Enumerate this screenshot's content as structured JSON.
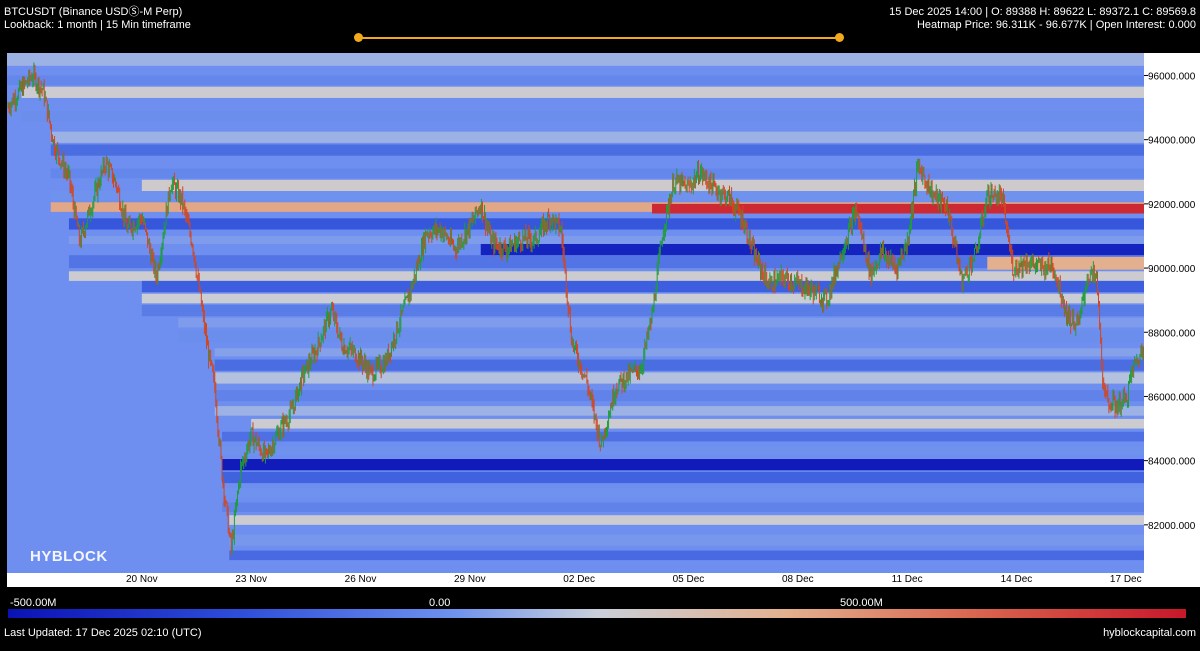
{
  "header": {
    "symbol": "BTCUSDT (Binance USDⓈ-M Perp)",
    "subtitle": "Lookback: 1 month | 15 Min timeframe",
    "ohlc": "15 Dec 2025 14:00 | O: 89388 H: 89622 L: 89372.1 C: 89569.8",
    "heatmap_info": "Heatmap Price: 96.311K - 96.677K | Open Interest: 0.000"
  },
  "watermark": "HYBLOCK",
  "footer": {
    "last_updated": "Last Updated: 17 Dec 2025 02:10 (UTC)",
    "site": "hyblockcapital.com"
  },
  "colors": {
    "background": "#000000",
    "plot_base": "#6e8ff0",
    "up_candle": "#1f9d3a",
    "down_candle": "#d2461f",
    "slider": "#f2a91c"
  },
  "colorbar": {
    "min_label": "-500.00M",
    "mid_label": "0.00",
    "max_label": "500.00M"
  },
  "chart_data": {
    "type": "heatmap",
    "title": "BTCUSDT (Binance USDⓈ-M Perp)",
    "x_ticks": [
      "20 Nov",
      "23 Nov",
      "26 Nov",
      "29 Nov",
      "02 Dec",
      "05 Dec",
      "08 Dec",
      "11 Dec",
      "14 Dec",
      "17 Dec"
    ],
    "x_tick_days": [
      4,
      7,
      10,
      13,
      16,
      19,
      22,
      25,
      28,
      31
    ],
    "x_range_days": [
      0.3,
      31.5
    ],
    "y_ticks": [
      "96000.000",
      "94000.000",
      "92000.000",
      "90000.000",
      "88000.000",
      "86000.000",
      "84000.000",
      "82000.000"
    ],
    "y_tick_values": [
      96000,
      94000,
      92000,
      90000,
      88000,
      86000,
      84000,
      82000
    ],
    "ylim": [
      80500,
      96700
    ],
    "colorbar_range": [
      -500000000,
      500000000
    ],
    "price_path": [
      [
        0.3,
        95000
      ],
      [
        0.7,
        95600
      ],
      [
        1.0,
        96000
      ],
      [
        1.3,
        95500
      ],
      [
        1.6,
        93800
      ],
      [
        2.0,
        92800
      ],
      [
        2.3,
        90800
      ],
      [
        2.6,
        91900
      ],
      [
        3.0,
        93300
      ],
      [
        3.3,
        92600
      ],
      [
        3.6,
        91200
      ],
      [
        4.0,
        91600
      ],
      [
        4.4,
        89700
      ],
      [
        4.8,
        92700
      ],
      [
        5.1,
        92100
      ],
      [
        5.4,
        90700
      ],
      [
        5.8,
        87500
      ],
      [
        6.0,
        86300
      ],
      [
        6.2,
        83600
      ],
      [
        6.45,
        81200
      ],
      [
        6.7,
        83700
      ],
      [
        7.0,
        84800
      ],
      [
        7.4,
        84100
      ],
      [
        7.8,
        85000
      ],
      [
        8.1,
        85500
      ],
      [
        8.4,
        86600
      ],
      [
        8.8,
        87500
      ],
      [
        9.2,
        88700
      ],
      [
        9.5,
        87600
      ],
      [
        9.9,
        87300
      ],
      [
        10.3,
        86700
      ],
      [
        10.7,
        87100
      ],
      [
        11.0,
        88100
      ],
      [
        11.4,
        89400
      ],
      [
        11.8,
        91100
      ],
      [
        12.2,
        91200
      ],
      [
        12.6,
        90600
      ],
      [
        13.0,
        91300
      ],
      [
        13.3,
        92000
      ],
      [
        13.6,
        90800
      ],
      [
        14.0,
        90600
      ],
      [
        14.4,
        90900
      ],
      [
        14.8,
        90900
      ],
      [
        15.2,
        91600
      ],
      [
        15.5,
        91200
      ],
      [
        15.8,
        87700
      ],
      [
        16.2,
        86500
      ],
      [
        16.6,
        84500
      ],
      [
        17.0,
        86300
      ],
      [
        17.3,
        86600
      ],
      [
        17.7,
        86900
      ],
      [
        18.0,
        88500
      ],
      [
        18.3,
        91200
      ],
      [
        18.6,
        92700
      ],
      [
        19.0,
        92500
      ],
      [
        19.3,
        93000
      ],
      [
        19.7,
        92500
      ],
      [
        20.1,
        92200
      ],
      [
        20.5,
        91500
      ],
      [
        20.8,
        90400
      ],
      [
        21.2,
        89500
      ],
      [
        21.6,
        89700
      ],
      [
        22.0,
        89500
      ],
      [
        22.4,
        89300
      ],
      [
        22.8,
        89000
      ],
      [
        23.2,
        90500
      ],
      [
        23.6,
        91800
      ],
      [
        24.0,
        89800
      ],
      [
        24.3,
        90500
      ],
      [
        24.7,
        90000
      ],
      [
        25.0,
        90800
      ],
      [
        25.3,
        93200
      ],
      [
        25.7,
        92300
      ],
      [
        26.1,
        91900
      ],
      [
        26.5,
        89600
      ],
      [
        26.9,
        90500
      ],
      [
        27.2,
        92300
      ],
      [
        27.6,
        92200
      ],
      [
        27.9,
        90000
      ],
      [
        28.3,
        90200
      ],
      [
        28.7,
        90000
      ],
      [
        29.0,
        90100
      ],
      [
        29.4,
        88500
      ],
      [
        29.7,
        88200
      ],
      [
        29.95,
        89800
      ],
      [
        30.2,
        89700
      ],
      [
        30.4,
        86000
      ],
      [
        30.7,
        85700
      ],
      [
        31.0,
        85900
      ],
      [
        31.2,
        86900
      ],
      [
        31.5,
        87500
      ]
    ],
    "heatmap_bands": [
      {
        "low": 96300,
        "high": 96700,
        "start_day": 0.3,
        "value": -60000000
      },
      {
        "low": 95700,
        "high": 96000,
        "start_day": 0.3,
        "value": -150000000
      },
      {
        "low": 95300,
        "high": 95650,
        "start_day": 0.7,
        "value": 20000000
      },
      {
        "low": 94550,
        "high": 94900,
        "start_day": 0.7,
        "value": -130000000
      },
      {
        "low": 93900,
        "high": 94250,
        "start_day": 1.5,
        "value": -60000000
      },
      {
        "low": 93500,
        "high": 93850,
        "start_day": 1.5,
        "value": -220000000
      },
      {
        "low": 92800,
        "high": 93100,
        "start_day": 1.5,
        "value": -150000000
      },
      {
        "low": 92400,
        "high": 92750,
        "start_day": 4.0,
        "value": 30000000
      },
      {
        "low": 92100,
        "high": 92400,
        "start_day": 1.5,
        "value": -120000000
      },
      {
        "low": 91750,
        "high": 92050,
        "start_day": 1.5,
        "value": 180000000
      },
      {
        "low": 91700,
        "high": 92000,
        "start_day": 18.0,
        "value": 460000000
      },
      {
        "low": 91200,
        "high": 91550,
        "start_day": 2.0,
        "value": -280000000
      },
      {
        "low": 90750,
        "high": 91000,
        "start_day": 2.0,
        "value": -100000000
      },
      {
        "low": 90400,
        "high": 90750,
        "start_day": 13.3,
        "value": -440000000
      },
      {
        "low": 90000,
        "high": 90400,
        "start_day": 2.0,
        "value": -200000000
      },
      {
        "low": 89950,
        "high": 90350,
        "start_day": 27.2,
        "value": 160000000
      },
      {
        "low": 89600,
        "high": 89900,
        "start_day": 2.0,
        "value": 20000000
      },
      {
        "low": 89250,
        "high": 89600,
        "start_day": 4.0,
        "value": -260000000
      },
      {
        "low": 88900,
        "high": 89200,
        "start_day": 4.0,
        "value": 10000000
      },
      {
        "low": 88500,
        "high": 88850,
        "start_day": 4.0,
        "value": -180000000
      },
      {
        "low": 88150,
        "high": 88450,
        "start_day": 5.0,
        "value": -100000000
      },
      {
        "low": 87700,
        "high": 88050,
        "start_day": 5.0,
        "value": -130000000
      },
      {
        "low": 87250,
        "high": 87500,
        "start_day": 6.0,
        "value": -90000000
      },
      {
        "low": 86800,
        "high": 87150,
        "start_day": 6.0,
        "value": -220000000
      },
      {
        "low": 86400,
        "high": 86750,
        "start_day": 6.0,
        "value": -30000000
      },
      {
        "low": 85850,
        "high": 86200,
        "start_day": 6.0,
        "value": -160000000
      },
      {
        "low": 85400,
        "high": 85700,
        "start_day": 6.0,
        "value": -60000000
      },
      {
        "low": 85000,
        "high": 85300,
        "start_day": 7.0,
        "value": 20000000
      },
      {
        "low": 84600,
        "high": 84900,
        "start_day": 6.2,
        "value": -210000000
      },
      {
        "low": 84200,
        "high": 84450,
        "start_day": 6.2,
        "value": -120000000
      },
      {
        "low": 83700,
        "high": 84050,
        "start_day": 6.2,
        "value": -470000000
      },
      {
        "low": 83300,
        "high": 83650,
        "start_day": 6.2,
        "value": -250000000
      },
      {
        "low": 82850,
        "high": 83150,
        "start_day": 6.2,
        "value": -120000000
      },
      {
        "low": 82400,
        "high": 82700,
        "start_day": 6.2,
        "value": -160000000
      },
      {
        "low": 82000,
        "high": 82300,
        "start_day": 6.4,
        "value": 20000000
      },
      {
        "low": 81350,
        "high": 81700,
        "start_day": 6.4,
        "value": -110000000
      },
      {
        "low": 80900,
        "high": 81200,
        "start_day": 6.4,
        "value": -230000000
      }
    ]
  }
}
